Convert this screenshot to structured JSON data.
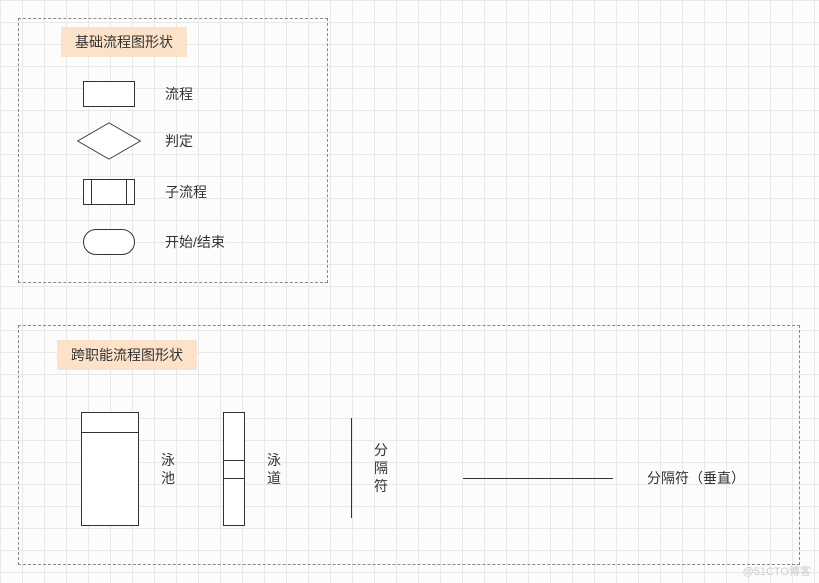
{
  "basic": {
    "title": "基础流程图形状",
    "process": "流程",
    "decision": "判定",
    "subprocess": "子流程",
    "terminator": "开始/结束"
  },
  "cross": {
    "title": "跨职能流程图形状",
    "pool": "泳池",
    "lane": "泳道",
    "separator": "分隔符",
    "separator_vertical": "分隔符（垂直）"
  },
  "watermark": "@51CTO博客"
}
